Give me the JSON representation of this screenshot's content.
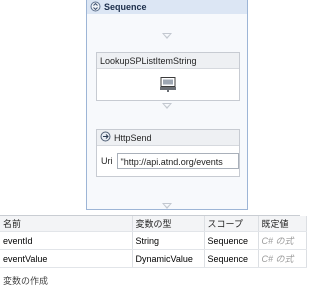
{
  "sequence": {
    "title": "Sequence",
    "lookup_activity": {
      "title": "LookupSPListItemString"
    },
    "http_activity": {
      "title": "HttpSend",
      "uri_label": "Uri",
      "uri_value": "\"http://api.atnd.org/events"
    }
  },
  "variables": {
    "columns": [
      "名前",
      "変数の型",
      "スコープ",
      "既定値"
    ],
    "rows": [
      {
        "name": "eventId",
        "type": "String",
        "scope": "Sequence",
        "default": "C# の式"
      },
      {
        "name": "eventValue",
        "type": "DynamicValue",
        "scope": "Sequence",
        "default": "C# の式"
      }
    ],
    "create_label": "変数の作成"
  },
  "icons": {
    "sequence": "sequence-icon",
    "lookup": "lookup-activity-icon",
    "http": "http-send-icon",
    "drop": "drop-target-arrow-icon"
  },
  "colors": {
    "header_bg": "#dce6f4",
    "border": "#9db5d6",
    "activity_header_bg": "#eef0f3"
  }
}
